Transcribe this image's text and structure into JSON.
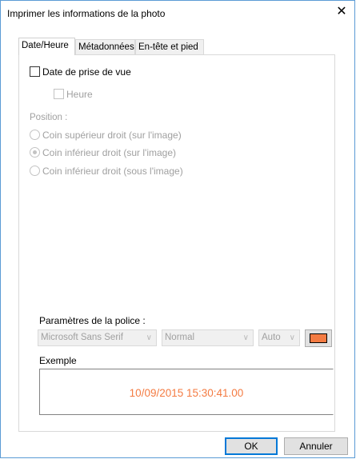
{
  "window": {
    "title": "Imprimer les informations de la photo",
    "close_glyph": "✕"
  },
  "tabs": [
    {
      "label": "Date/Heure",
      "active": true
    },
    {
      "label": "Métadonnées",
      "active": false
    },
    {
      "label": "En-tête et pied",
      "active": false
    }
  ],
  "date_section": {
    "date_checkbox_label": "Date de prise de vue",
    "time_checkbox_label": "Heure"
  },
  "position": {
    "label": "Position :",
    "options": [
      {
        "label": "Coin supérieur droit (sur l'image)",
        "checked": false
      },
      {
        "label": "Coin inférieur droit (sur l'image)",
        "checked": true
      },
      {
        "label": "Coin inférieur droit (sous l'image)",
        "checked": false
      }
    ]
  },
  "font_settings": {
    "label": "Paramètres de la police :",
    "font_family": "Microsoft Sans Serif",
    "font_style": "Normal",
    "font_size": "Auto",
    "font_color": "#f47b42"
  },
  "example": {
    "label": "Exemple",
    "text": "10/09/2015 15:30:41.00"
  },
  "buttons": {
    "ok": "OK",
    "cancel": "Annuler"
  }
}
